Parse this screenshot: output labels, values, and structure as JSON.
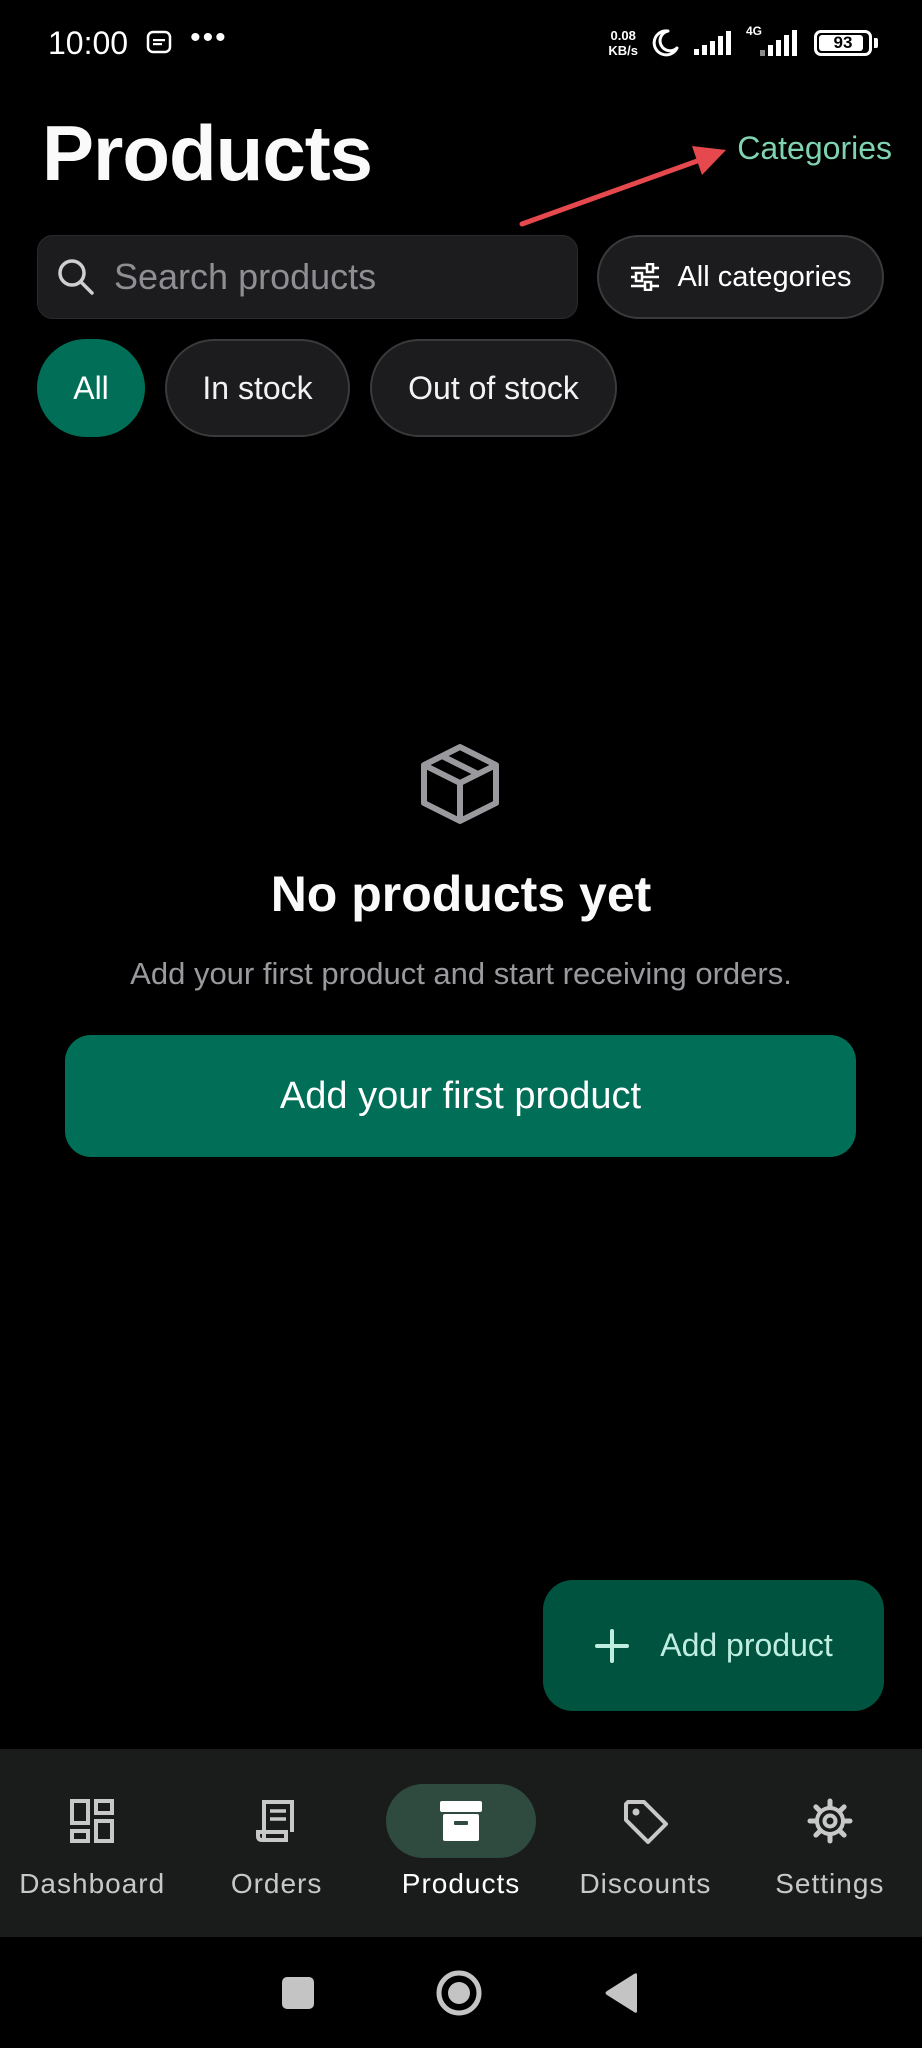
{
  "status_bar": {
    "time": "10:00",
    "dots": "•••",
    "net_speed_value": "0.08",
    "net_speed_unit": "KB/s",
    "network_type": "4G",
    "battery": "93",
    "icons": [
      "message-icon",
      "moon-icon",
      "signal-icon",
      "signal-4g-icon",
      "battery-icon"
    ]
  },
  "header": {
    "title": "Products",
    "categories_link": "Categories"
  },
  "search": {
    "placeholder": "Search products"
  },
  "filter_button": {
    "label": "All categories",
    "icon": "sliders-icon"
  },
  "chips": [
    {
      "label": "All",
      "active": true
    },
    {
      "label": "In stock",
      "active": false
    },
    {
      "label": "Out of stock",
      "active": false
    }
  ],
  "empty_state": {
    "icon": "box-icon",
    "title": "No products yet",
    "subtitle": "Add your first product and start receiving orders.",
    "button_label": "Add your first product"
  },
  "fab": {
    "label": "Add product",
    "icon": "plus-icon"
  },
  "bottom_nav": {
    "items": [
      {
        "label": "Dashboard",
        "icon": "dashboard-icon",
        "active": false
      },
      {
        "label": "Orders",
        "icon": "receipt-icon",
        "active": false
      },
      {
        "label": "Products",
        "icon": "archive-icon",
        "active": true
      },
      {
        "label": "Discounts",
        "icon": "tag-icon",
        "active": false
      },
      {
        "label": "Settings",
        "icon": "gear-icon",
        "active": false
      }
    ]
  },
  "colors": {
    "accent": "#016e57",
    "accent_dark": "#00533f",
    "link": "#7fd3b1",
    "annotation_arrow": "#e5484d",
    "background": "#000000"
  }
}
